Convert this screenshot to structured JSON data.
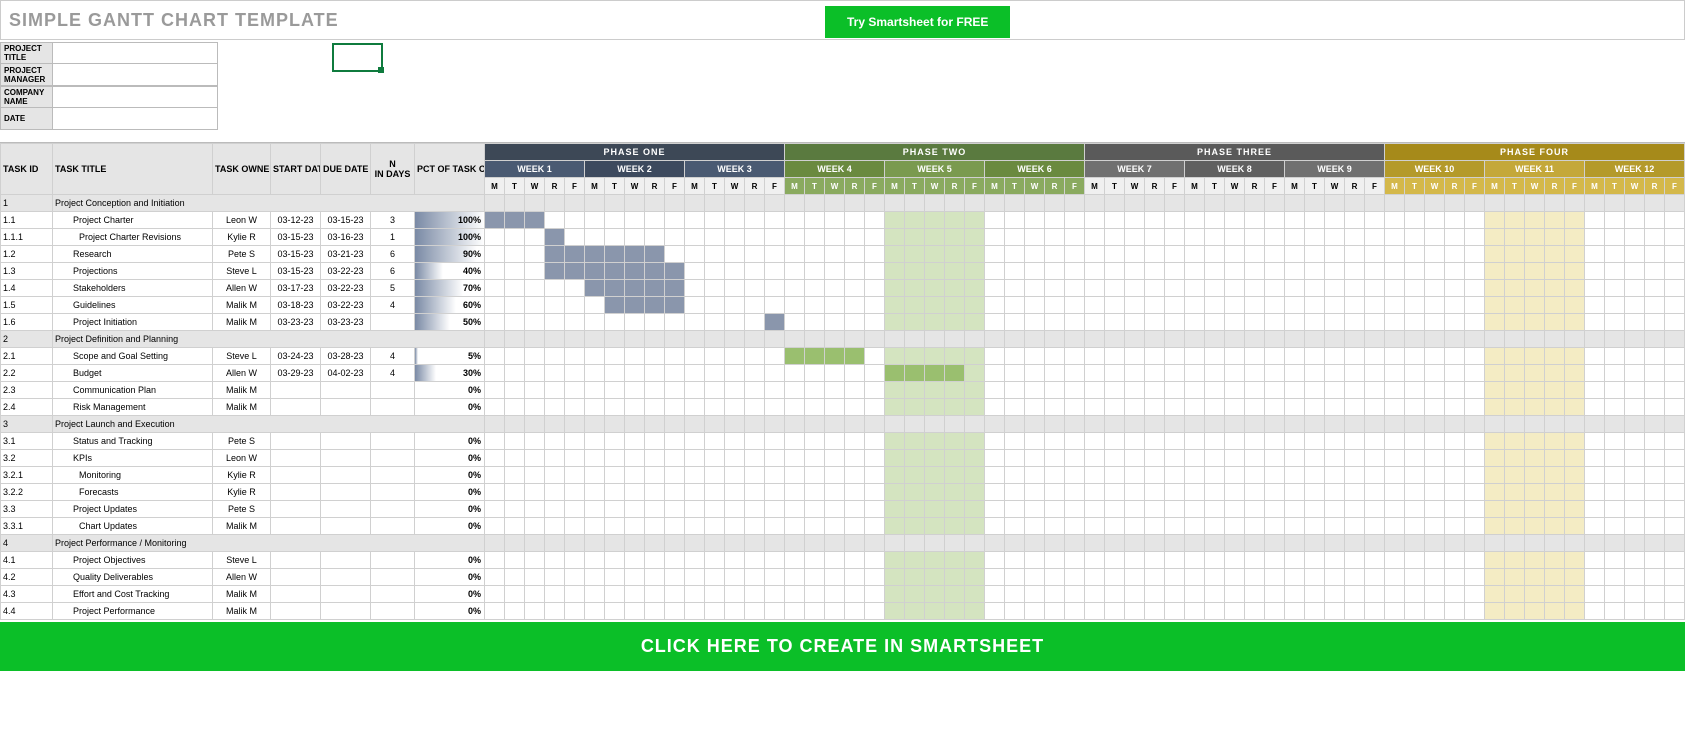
{
  "title": "SIMPLE GANTT CHART TEMPLATE",
  "try_btn": "Try Smartsheet for FREE",
  "meta": [
    {
      "l": "PROJECT TITLE",
      "v": ""
    },
    {
      "l": "PROJECT MANAGER",
      "v": ""
    },
    {
      "l": "COMPANY NAME",
      "v": ""
    },
    {
      "l": "DATE",
      "v": ""
    }
  ],
  "headers": {
    "id": "TASK ID",
    "title": "TASK TITLE",
    "owner": "TASK OWNER",
    "start": "START DATE",
    "due": "DUE DATE",
    "dur_top": "N",
    "dur_bot": "IN DAYS",
    "pct": "PCT OF TASK COMPLETE"
  },
  "phases": [
    "PHASE ONE",
    "PHASE TWO",
    "PHASE THREE",
    "PHASE FOUR"
  ],
  "weeks": [
    "WEEK 1",
    "WEEK 2",
    "WEEK 3",
    "WEEK 4",
    "WEEK 5",
    "WEEK 6",
    "WEEK 7",
    "WEEK 8",
    "WEEK 9",
    "WEEK 10",
    "WEEK 11",
    "WEEK 12"
  ],
  "days": [
    "M",
    "T",
    "W",
    "R",
    "F"
  ],
  "rows": [
    {
      "type": "sec",
      "id": "1",
      "title": "Project Conception and Initiation"
    },
    {
      "id": "1.1",
      "title": "Project Charter",
      "ind": 1,
      "owner": "Leon W",
      "start": "03-12-23",
      "due": "03-15-23",
      "dur": "3",
      "pct": 100,
      "bar": [
        0,
        3
      ]
    },
    {
      "id": "1.1.1",
      "title": "Project Charter Revisions",
      "ind": 2,
      "owner": "Kylie R",
      "start": "03-15-23",
      "due": "03-16-23",
      "dur": "1",
      "pct": 100,
      "bar": [
        3,
        4
      ]
    },
    {
      "id": "1.2",
      "title": "Research",
      "ind": 1,
      "owner": "Pete S",
      "start": "03-15-23",
      "due": "03-21-23",
      "dur": "6",
      "pct": 90,
      "bar": [
        3,
        9
      ]
    },
    {
      "id": "1.3",
      "title": "Projections",
      "ind": 1,
      "owner": "Steve L",
      "start": "03-15-23",
      "due": "03-22-23",
      "dur": "6",
      "pct": 40,
      "bar": [
        3,
        10
      ]
    },
    {
      "id": "1.4",
      "title": "Stakeholders",
      "ind": 1,
      "owner": "Allen W",
      "start": "03-17-23",
      "due": "03-22-23",
      "dur": "5",
      "pct": 70,
      "bar": [
        5,
        10
      ]
    },
    {
      "id": "1.5",
      "title": "Guidelines",
      "ind": 1,
      "owner": "Malik M",
      "start": "03-18-23",
      "due": "03-22-23",
      "dur": "4",
      "pct": 60,
      "bar": [
        6,
        10
      ]
    },
    {
      "id": "1.6",
      "title": "Project Initiation",
      "ind": 1,
      "owner": "Malik M",
      "start": "03-23-23",
      "due": "03-23-23",
      "dur": "",
      "pct": 50,
      "bar": [
        14,
        15
      ]
    },
    {
      "type": "sec",
      "id": "2",
      "title": "Project Definition and Planning"
    },
    {
      "id": "2.1",
      "title": "Scope and Goal Setting",
      "ind": 1,
      "owner": "Steve L",
      "start": "03-24-23",
      "due": "03-28-23",
      "dur": "4",
      "pct": 5,
      "gbar": [
        15,
        19
      ]
    },
    {
      "id": "2.2",
      "title": "Budget",
      "ind": 1,
      "owner": "Allen W",
      "start": "03-29-23",
      "due": "04-02-23",
      "dur": "4",
      "pct": 30,
      "gbar": [
        20,
        24
      ]
    },
    {
      "id": "2.3",
      "title": "Communication Plan",
      "ind": 1,
      "owner": "Malik M",
      "start": "",
      "due": "",
      "dur": "",
      "pct": 0
    },
    {
      "id": "2.4",
      "title": "Risk Management",
      "ind": 1,
      "owner": "Malik M",
      "start": "",
      "due": "",
      "dur": "",
      "pct": 0
    },
    {
      "type": "sec",
      "id": "3",
      "title": "Project Launch and Execution"
    },
    {
      "id": "3.1",
      "title": "Status and Tracking",
      "ind": 1,
      "owner": "Pete S",
      "start": "",
      "due": "",
      "dur": "",
      "pct": 0
    },
    {
      "id": "3.2",
      "title": "KPIs",
      "ind": 1,
      "owner": "Leon W",
      "start": "",
      "due": "",
      "dur": "",
      "pct": 0
    },
    {
      "id": "3.2.1",
      "title": "Monitoring",
      "ind": 2,
      "owner": "Kylie R",
      "start": "",
      "due": "",
      "dur": "",
      "pct": 0
    },
    {
      "id": "3.2.2",
      "title": "Forecasts",
      "ind": 2,
      "owner": "Kylie R",
      "start": "",
      "due": "",
      "dur": "",
      "pct": 0
    },
    {
      "id": "3.3",
      "title": "Project Updates",
      "ind": 1,
      "owner": "Pete S",
      "start": "",
      "due": "",
      "dur": "",
      "pct": 0
    },
    {
      "id": "3.3.1",
      "title": "Chart Updates",
      "ind": 2,
      "owner": "Malik M",
      "start": "",
      "due": "",
      "dur": "",
      "pct": 0
    },
    {
      "type": "sec",
      "id": "4",
      "title": "Project Performance / Monitoring"
    },
    {
      "id": "4.1",
      "title": "Project Objectives",
      "ind": 1,
      "owner": "Steve L",
      "start": "",
      "due": "",
      "dur": "",
      "pct": 0
    },
    {
      "id": "4.2",
      "title": "Quality Deliverables",
      "ind": 1,
      "owner": "Allen W",
      "start": "",
      "due": "",
      "dur": "",
      "pct": 0
    },
    {
      "id": "4.3",
      "title": "Effort and Cost Tracking",
      "ind": 1,
      "owner": "Malik M",
      "start": "",
      "due": "",
      "dur": "",
      "pct": 0
    },
    {
      "id": "4.4",
      "title": "Project Performance",
      "ind": 1,
      "owner": "Malik M",
      "start": "",
      "due": "",
      "dur": "",
      "pct": 0
    }
  ],
  "footer": "CLICK HERE TO CREATE IN SMARTSHEET"
}
